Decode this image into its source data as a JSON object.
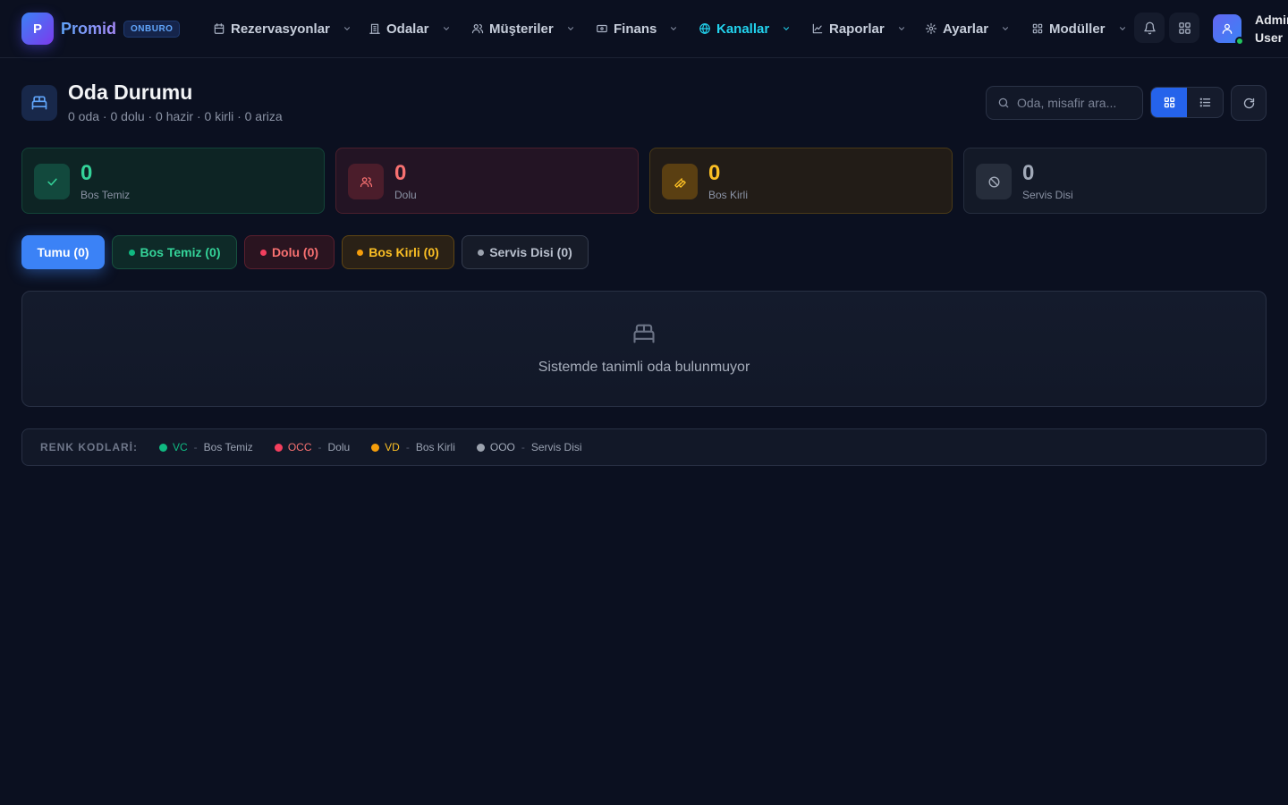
{
  "brand": {
    "logo_letter": "P",
    "name": "Promid",
    "badge": "ONBURO"
  },
  "nav": {
    "items": [
      {
        "label": "Rezervasyonlar",
        "icon": "calendar-icon"
      },
      {
        "label": "Odalar",
        "icon": "building-icon"
      },
      {
        "label": "Müşteriler",
        "icon": "users-icon"
      },
      {
        "label": "Finans",
        "icon": "wallet-icon"
      },
      {
        "label": "Kanallar",
        "icon": "globe-icon",
        "active": true
      },
      {
        "label": "Raporlar",
        "icon": "chart-icon"
      },
      {
        "label": "Ayarlar",
        "icon": "gear-icon"
      },
      {
        "label": "Modüller",
        "icon": "grid-icon"
      }
    ]
  },
  "user": {
    "name_line1": "Admin",
    "name_line2": "User",
    "status": "online"
  },
  "page": {
    "title": "Oda Durumu",
    "subtitle": "0 oda · 0 dolu · 0 hazir · 0 kirli · 0 ariza",
    "icon": "bed-icon"
  },
  "search": {
    "placeholder": "Oda, misafir ara...",
    "value": ""
  },
  "view_mode": "grid",
  "stats": [
    {
      "value": "0",
      "label": "Bos Temiz",
      "icon": "check-icon",
      "color": "#34d399"
    },
    {
      "value": "0",
      "label": "Dolu",
      "icon": "users-icon",
      "color": "#f87171"
    },
    {
      "value": "0",
      "label": "Bos Kirli",
      "icon": "wrench-icon",
      "color": "#fbbf24"
    },
    {
      "value": "0",
      "label": "Servis Disi",
      "icon": "ban-icon",
      "color": "#a1a9b8"
    }
  ],
  "filters": [
    {
      "label": "Tumu (0)",
      "active": true
    },
    {
      "label": "Bos Temiz (0)",
      "color": "#10b981"
    },
    {
      "label": "Dolu (0)",
      "color": "#f43f5e"
    },
    {
      "label": "Bos Kirli (0)",
      "color": "#f59e0b"
    },
    {
      "label": "Servis Disi (0)",
      "color": "#9ca3af"
    }
  ],
  "empty_state": {
    "text": "Sistemde tanimli oda bulunmuyor",
    "icon": "bed-icon"
  },
  "legend": {
    "title": "RENK KODLARİ:",
    "items": [
      {
        "code": "VC",
        "name": "Bos Temiz",
        "color": "#10b981"
      },
      {
        "code": "OCC",
        "name": "Dolu",
        "color": "#f43f5e"
      },
      {
        "code": "VD",
        "name": "Bos Kirli",
        "color": "#f59e0b"
      },
      {
        "code": "OOO",
        "name": "Servis Disi",
        "color": "#9ca3af"
      }
    ],
    "separator": "-"
  }
}
